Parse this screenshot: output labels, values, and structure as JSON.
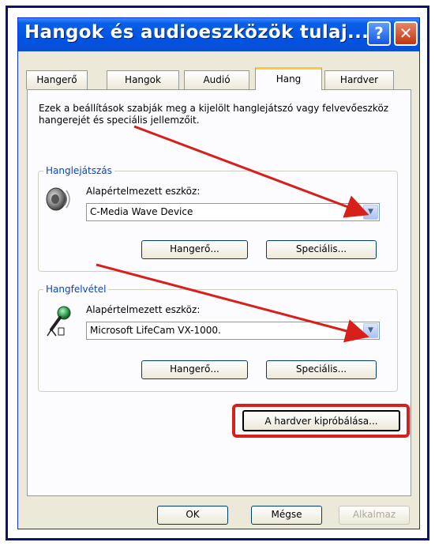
{
  "window": {
    "title": "Hangok és audioeszközök tulaj...",
    "help_glyph": "?",
    "close_glyph": "✕"
  },
  "tabs": [
    {
      "label": "Hangerő"
    },
    {
      "label": "Hangok"
    },
    {
      "label": "Audió"
    },
    {
      "label": "Hang",
      "active": true
    },
    {
      "label": "Hardver"
    }
  ],
  "description": "Ezek a beállítások szabják meg a kijelölt hanglejátszó vagy felvevőeszköz hangerejét és speciális jellemzőit.",
  "playback": {
    "legend": "Hanglejátszás",
    "device_label": "Alapértelmezett eszköz:",
    "device_value": "C-Media Wave Device",
    "volume_button": "Hangerő...",
    "advanced_button": "Speciális..."
  },
  "recording": {
    "legend": "Hangfelvétel",
    "device_label": "Alapértelmezett eszköz:",
    "device_value": "Microsoft LifeCam VX-1000.",
    "volume_button": "Hangerő...",
    "advanced_button": "Speciális..."
  },
  "test_hardware_button": "A hardver kipróbálása...",
  "footer": {
    "ok": "OK",
    "cancel": "Mégse",
    "apply": "Alkalmaz"
  },
  "colors": {
    "title_bar": "#0054e3",
    "group_legend": "#0046d5",
    "annotation": "#d8201a",
    "outer_frame": "#0a1470"
  },
  "icons": {
    "playback": "speaker-icon",
    "recording": "microphone-icon",
    "dropdown": "chevron-down-icon"
  }
}
